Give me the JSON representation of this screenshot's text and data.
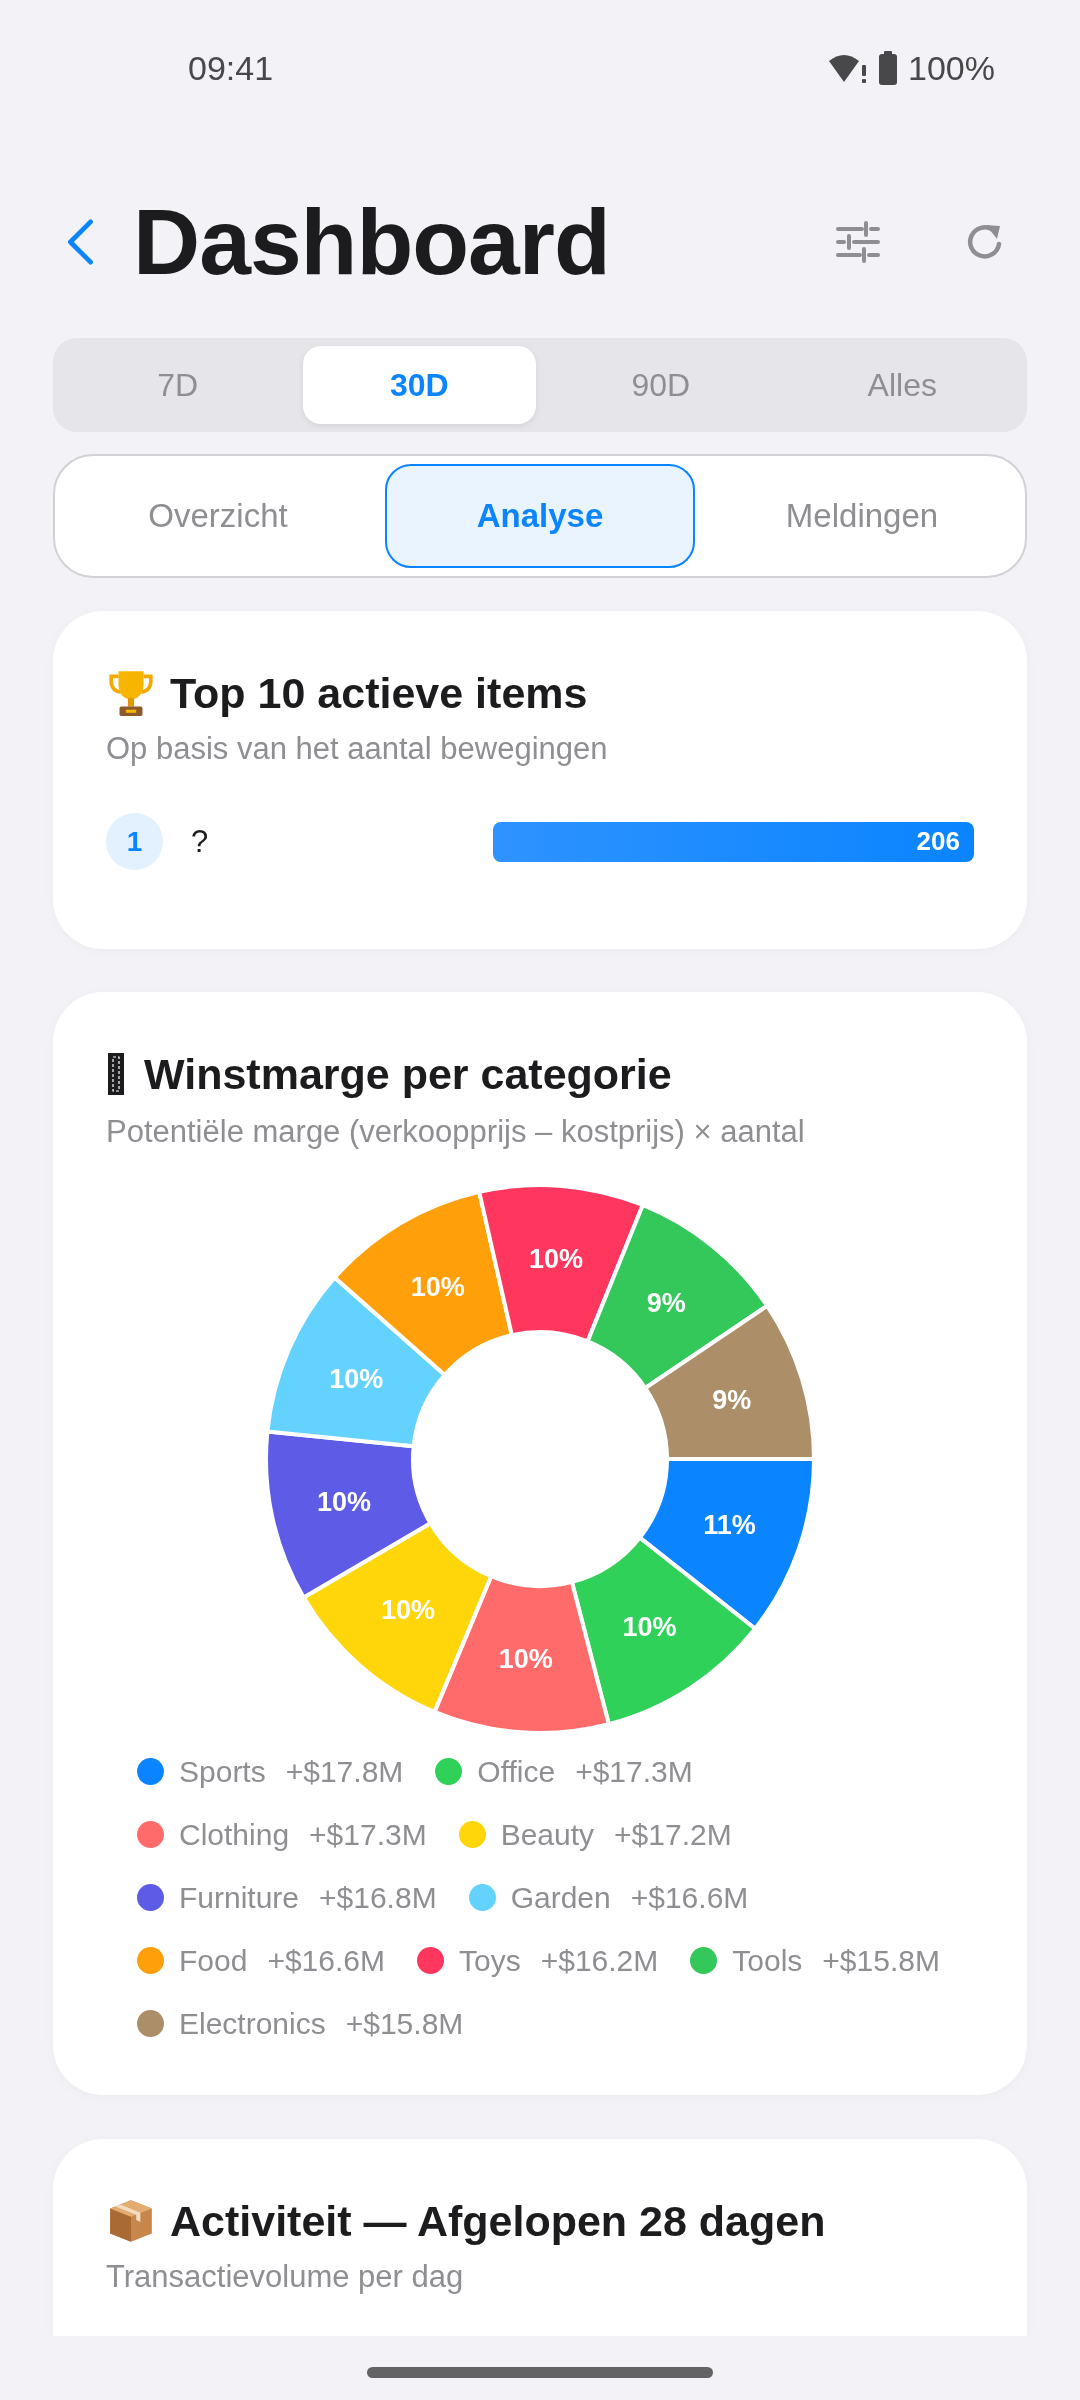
{
  "status_bar": {
    "time": "09:41",
    "battery": "100%"
  },
  "header": {
    "title": "Dashboard"
  },
  "period_tabs": [
    {
      "label": "7D",
      "selected": false
    },
    {
      "label": "30D",
      "selected": true
    },
    {
      "label": "90D",
      "selected": false
    },
    {
      "label": "Alles",
      "selected": false
    }
  ],
  "view_tabs": [
    {
      "label": "Overzicht",
      "selected": false
    },
    {
      "label": "Analyse",
      "selected": true
    },
    {
      "label": "Meldingen",
      "selected": false
    }
  ],
  "top_items": {
    "title": "Top 10 actieve items",
    "subtitle": "Op basis van het aantal bewegingen",
    "rows": [
      {
        "rank": "1",
        "name": "?",
        "value": "206",
        "level": 1
      }
    ]
  },
  "margin_card": {
    "title": "Winstmarge per categorie",
    "subtitle": "Potentiële marge (verkoopprijs – kostprijs) × aantal",
    "chart_data": {
      "type": "donut",
      "categories": [
        "Sports",
        "Office",
        "Clothing",
        "Beauty",
        "Furniture",
        "Garden",
        "Food",
        "Toys",
        "Tools",
        "Electronics"
      ],
      "values": [
        10.63,
        10.33,
        10.33,
        10.27,
        10.04,
        9.92,
        9.92,
        9.68,
        9.44,
        9.44
      ],
      "value_labels": [
        "11%",
        "10%",
        "10%",
        "10%",
        "10%",
        "10%",
        "10%",
        "10%",
        "9%",
        "9%"
      ]
    },
    "legend": [
      {
        "value": "+$17.8M",
        "color": "#0a84ff"
      },
      {
        "value": "+$17.3M",
        "color": "#30d158"
      },
      {
        "value": "+$17.3M",
        "color": "#ff6b6b"
      },
      {
        "value": "+$17.2M",
        "color": "#ffd60a"
      },
      {
        "value": "+$16.8M",
        "color": "#5e5ce6"
      },
      {
        "value": "+$16.6M",
        "color": "#64d2ff"
      },
      {
        "value": "+$16.6M",
        "color": "#ff9f0a"
      },
      {
        "value": "+$16.2M",
        "color": "#ff375f"
      },
      {
        "value": "+$15.8M",
        "color": "#34c759"
      },
      {
        "value": "+$15.8M",
        "color": "#ac8e68"
      }
    ]
  },
  "activity_card": {
    "title": "Activiteit — Afgelopen 28 dagen",
    "subtitle": "Transactievolume per dag"
  }
}
